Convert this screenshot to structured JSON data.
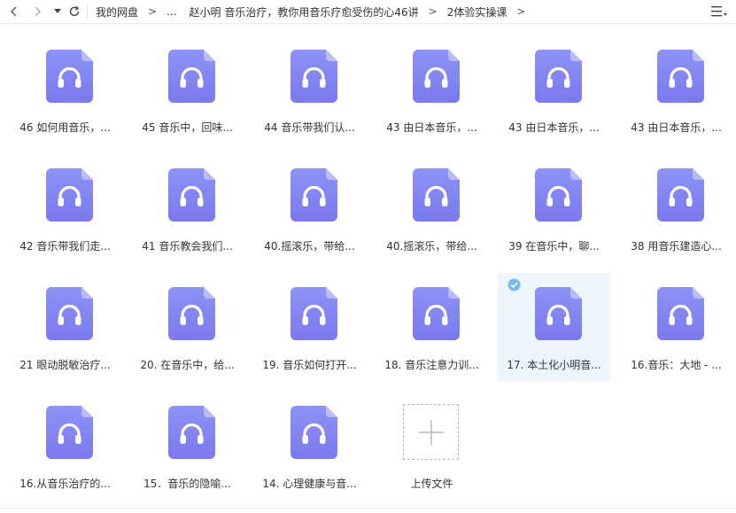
{
  "breadcrumb": [
    "我的网盘",
    "...",
    "赵小明 音乐治疗，教你用音乐疗愈受伤的心46讲",
    "2体验实操课"
  ],
  "breadcrumb_sep": ">",
  "files": [
    {
      "name": "46 如何用音乐，..."
    },
    {
      "name": "45 音乐中，回味..."
    },
    {
      "name": "44 音乐带我们认..."
    },
    {
      "name": "43 由日本音乐，..."
    },
    {
      "name": "43 由日本音乐，..."
    },
    {
      "name": "43 由日本音乐，..."
    },
    {
      "name": "42 音乐带我们走..."
    },
    {
      "name": "41 音乐教会我们..."
    },
    {
      "name": "40.摇滚乐，带给..."
    },
    {
      "name": "40.摇滚乐，带给..."
    },
    {
      "name": "39 在音乐中，聊..."
    },
    {
      "name": "38 用音乐建造心..."
    },
    {
      "name": "21 眼动脱敏治疗..."
    },
    {
      "name": "20. 在音乐中，给..."
    },
    {
      "name": "19. 音乐如何打开..."
    },
    {
      "name": "18. 音乐注意力训..."
    },
    {
      "name": "17. 本土化小明音...",
      "selected": true
    },
    {
      "name": "16.音乐：大地 - ..."
    },
    {
      "name": "16.从音乐治疗的..."
    },
    {
      "name": "15．音乐的隐喻..."
    },
    {
      "name": "14. 心理健康与音..."
    }
  ],
  "upload": {
    "label": "上传文件"
  },
  "icons": {
    "back": "chevron-left-icon",
    "forward": "chevron-right-icon",
    "history": "caret-down-icon",
    "refresh": "refresh-icon",
    "view": "list-view-icon",
    "file": "audio-file-icon",
    "selected": "check-circle-icon",
    "upload": "plus-icon"
  },
  "colors": {
    "file_icon_top": "#8d93f6",
    "file_icon_bottom": "#7a79ee",
    "selected_bg": "#eef6fd",
    "check": "#7bb8ec"
  }
}
